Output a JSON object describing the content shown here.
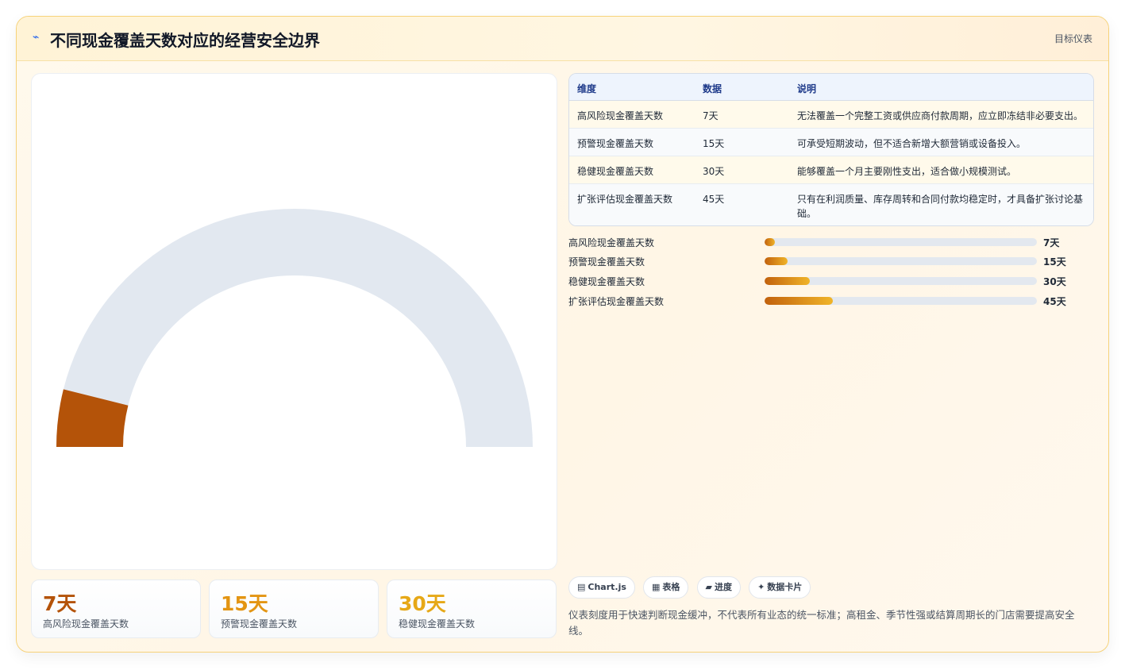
{
  "header": {
    "icon": "trend-icon",
    "title": "不同现金覆盖天数对应的经营安全边界",
    "badge": "目标仪表"
  },
  "chart_data": {
    "type": "gauge",
    "value": 7,
    "max": 90,
    "unit": "天",
    "track_color": "#e2e8f0",
    "fill_color": "#b45309"
  },
  "stats": [
    {
      "value": "7天",
      "label": "高风险现金覆盖天数",
      "color": "#b45309"
    },
    {
      "value": "15天",
      "label": "预警现金覆盖天数",
      "color": "#e39513"
    },
    {
      "value": "30天",
      "label": "稳健现金覆盖天数",
      "color": "#e6a817"
    }
  ],
  "table": {
    "headers": [
      "维度",
      "数据",
      "说明"
    ],
    "rows": [
      {
        "dim": "高风险现金覆盖天数",
        "data": "7天",
        "desc": "无法覆盖一个完整工资或供应商付款周期，应立即冻结非必要支出。"
      },
      {
        "dim": "预警现金覆盖天数",
        "data": "15天",
        "desc": "可承受短期波动，但不适合新增大额营销或设备投入。"
      },
      {
        "dim": "稳健现金覆盖天数",
        "data": "30天",
        "desc": "能够覆盖一个月主要刚性支出，适合做小规模测试。"
      },
      {
        "dim": "扩张评估现金覆盖天数",
        "data": "45天",
        "desc": "只有在利润质量、库存周转和合同付款均稳定时，才具备扩张讨论基础。"
      }
    ]
  },
  "progress": {
    "max": 180,
    "items": [
      {
        "label": "高风险现金覆盖天数",
        "value": 7,
        "text": "7天"
      },
      {
        "label": "预警现金覆盖天数",
        "value": 15,
        "text": "15天"
      },
      {
        "label": "稳健现金覆盖天数",
        "value": 30,
        "text": "30天"
      },
      {
        "label": "扩张评估现金覆盖天数",
        "value": 45,
        "text": "45天"
      }
    ]
  },
  "chips": [
    {
      "icon": "chart-icon",
      "glyph": "▤",
      "label": "Chart.js"
    },
    {
      "icon": "table-icon",
      "glyph": "▦",
      "label": "表格"
    },
    {
      "icon": "progress-icon",
      "glyph": "▰",
      "label": "进度"
    },
    {
      "icon": "card-icon",
      "glyph": "✦",
      "label": "数据卡片"
    }
  ],
  "note": "仪表刻度用于快速判断现金缓冲，不代表所有业态的统一标准；高租金、季节性强或结算周期长的门店需要提高安全线。"
}
